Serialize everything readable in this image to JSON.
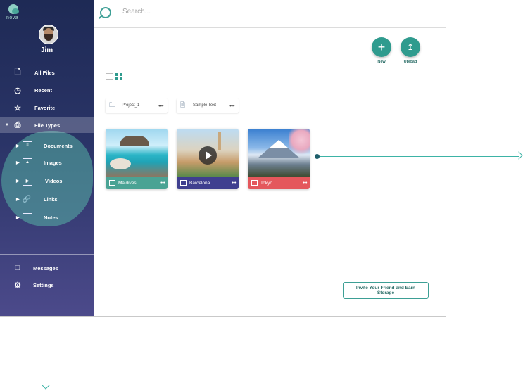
{
  "app": {
    "logo_text": "nova"
  },
  "user": {
    "name": "Jim"
  },
  "sidebar": {
    "items": [
      {
        "label": "All Files",
        "icon": "file-copy-icon"
      },
      {
        "label": "Recent",
        "icon": "clock-icon"
      },
      {
        "label": "Favorite",
        "icon": "star-icon"
      },
      {
        "label": "File Types",
        "icon": "printer-icon",
        "active": true,
        "expanded": true
      }
    ],
    "sub_items": [
      {
        "label": "Documents",
        "icon": "document-icon"
      },
      {
        "label": "Images",
        "icon": "image-icon"
      },
      {
        "label": "Videos",
        "icon": "video-icon"
      },
      {
        "label": "Links",
        "icon": "link-icon"
      },
      {
        "label": "Notes",
        "icon": "notes-icon"
      }
    ],
    "bottom_items": [
      {
        "label": "Messages",
        "icon": "message-icon"
      },
      {
        "label": "Settings",
        "icon": "gear-icon"
      }
    ]
  },
  "search": {
    "placeholder": "Search...",
    "value": ""
  },
  "actions": {
    "new_label": "New",
    "upload_label": "Upload"
  },
  "folders": [
    {
      "label": "Project_1",
      "icon": "folder-icon"
    },
    {
      "label": "Sample Text",
      "icon": "file-icon"
    }
  ],
  "media": [
    {
      "label": "Maldives",
      "type": "image",
      "color": "#4aa394"
    },
    {
      "label": "Barcelona",
      "type": "video",
      "color": "#3f3f8f"
    },
    {
      "label": "Tokyo",
      "type": "image",
      "color": "#e4575c"
    }
  ],
  "invite": {
    "label": "Invite Your Friend and Earn Storage"
  },
  "colors": {
    "accent": "#2f9b8e",
    "sidebar_top": "#1e2a55",
    "sidebar_bottom": "#4c4a8b"
  }
}
